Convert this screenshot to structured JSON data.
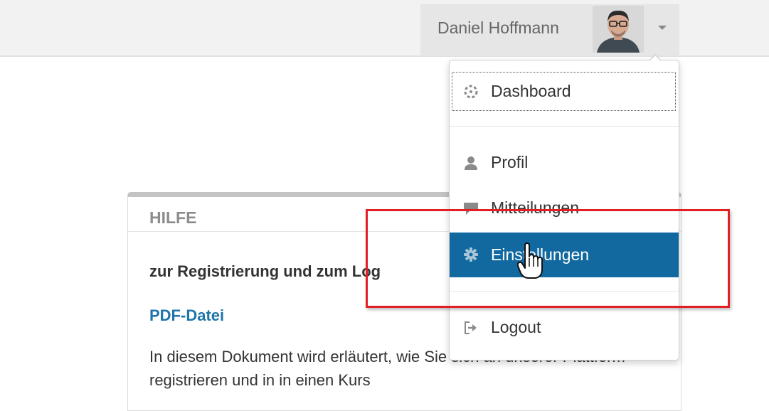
{
  "header": {
    "user_name": "Daniel Hoffmann"
  },
  "user_menu": {
    "items": [
      {
        "label": "Dashboard",
        "icon": "dashboard-icon"
      },
      {
        "label": "Profil",
        "icon": "user-icon"
      },
      {
        "label": "Mitteilungen",
        "icon": "message-icon"
      },
      {
        "label": "Einstellungen",
        "icon": "gear-icon",
        "active": true
      },
      {
        "label": "Logout",
        "icon": "logout-icon"
      }
    ]
  },
  "help_block": {
    "title": "HILFE",
    "subtitle": "zur Registrierung und zum Log",
    "link": "PDF-Datei",
    "text": "In diesem Dokument wird erläutert, wie Sie sich an unserer Plattform registrieren und in in einen Kurs"
  },
  "colors": {
    "active_item": "#1169a0",
    "link": "#1f74aa",
    "annotation": "#e31e24"
  }
}
